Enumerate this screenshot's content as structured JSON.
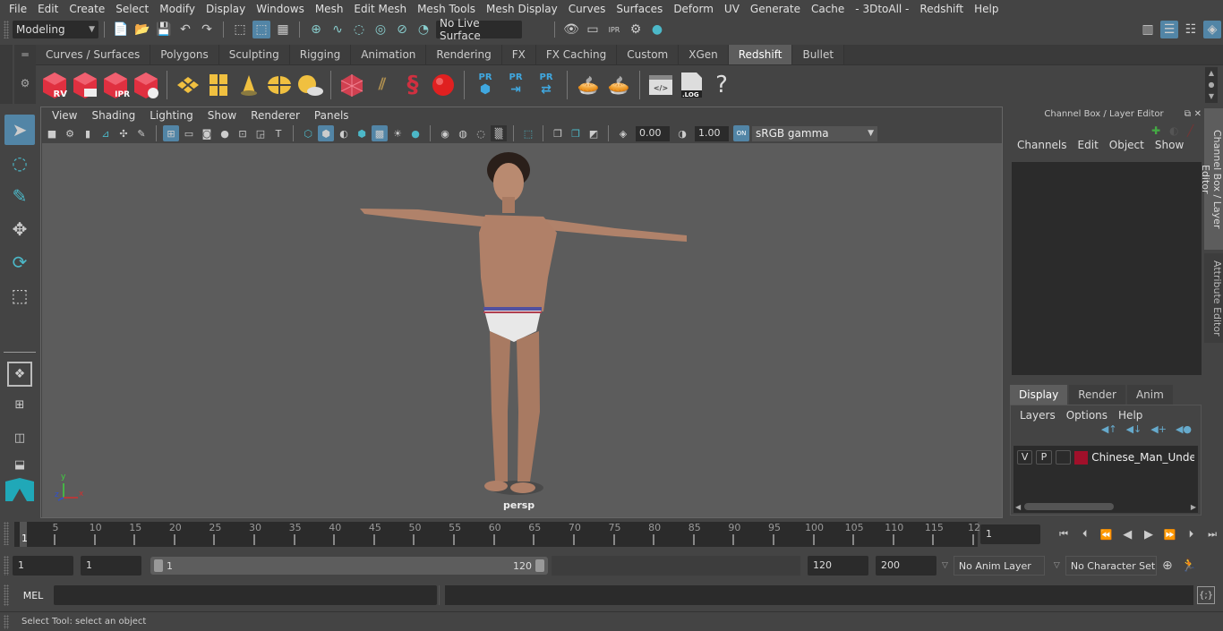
{
  "menubar": [
    "File",
    "Edit",
    "Create",
    "Select",
    "Modify",
    "Display",
    "Windows",
    "Mesh",
    "Edit Mesh",
    "Mesh Tools",
    "Mesh Display",
    "Curves",
    "Surfaces",
    "Deform",
    "UV",
    "Generate",
    "Cache",
    "- 3DtoAll -",
    "Redshift",
    "Help"
  ],
  "statusline": {
    "mode": "Modeling",
    "live_surface": "No Live Surface"
  },
  "shelf_tabs": [
    "Curves / Surfaces",
    "Polygons",
    "Sculpting",
    "Rigging",
    "Animation",
    "Rendering",
    "FX",
    "FX Caching",
    "Custom",
    "XGen",
    "Redshift",
    "Bullet"
  ],
  "shelf_selected": "Redshift",
  "shelf_icons": {
    "rv": "RV",
    "ipr": "IPR",
    "pr": "PR",
    "log": ".LOG",
    "help": "?"
  },
  "viewport": {
    "menu": [
      "View",
      "Shading",
      "Lighting",
      "Show",
      "Renderer",
      "Panels"
    ],
    "exposure": "0.00",
    "gamma": "1.00",
    "color_space": "sRGB gamma",
    "camera_label": "persp",
    "axis": {
      "x": "x",
      "y": "y",
      "z": "z"
    }
  },
  "channel_box": {
    "title": "Channel Box / Layer Editor",
    "menu": [
      "Channels",
      "Edit",
      "Object",
      "Show"
    ]
  },
  "layer_editor": {
    "tabs": [
      "Display",
      "Render",
      "Anim"
    ],
    "selected_tab": "Display",
    "menu": [
      "Layers",
      "Options",
      "Help"
    ],
    "layers": [
      {
        "v": "V",
        "p": "P",
        "color": "#a0102a",
        "name": "Chinese_Man_Underw"
      }
    ]
  },
  "side_tabs": [
    "Channel Box / Layer Editor",
    "Attribute Editor"
  ],
  "timeline": {
    "start_label": "1",
    "ticks": [
      "5",
      "10",
      "15",
      "20",
      "25",
      "30",
      "35",
      "40",
      "45",
      "50",
      "55",
      "60",
      "65",
      "70",
      "75",
      "80",
      "85",
      "90",
      "95",
      "100",
      "105",
      "110",
      "115",
      "12"
    ],
    "current_frame": "1"
  },
  "range": {
    "start": "1",
    "playback_start": "1",
    "slider_min": "1",
    "slider_max": "120",
    "playback_end": "120",
    "end": "200",
    "anim_layer": "No Anim Layer",
    "character_set": "No Character Set"
  },
  "command": {
    "lang": "MEL",
    "input": "",
    "output": ""
  },
  "help_line": "Select Tool: select an object",
  "colors": {
    "accent": "#5285a6",
    "redshift_red": "#e03040",
    "yellow": "#f0c040",
    "pr_blue": "#40a8e0"
  }
}
